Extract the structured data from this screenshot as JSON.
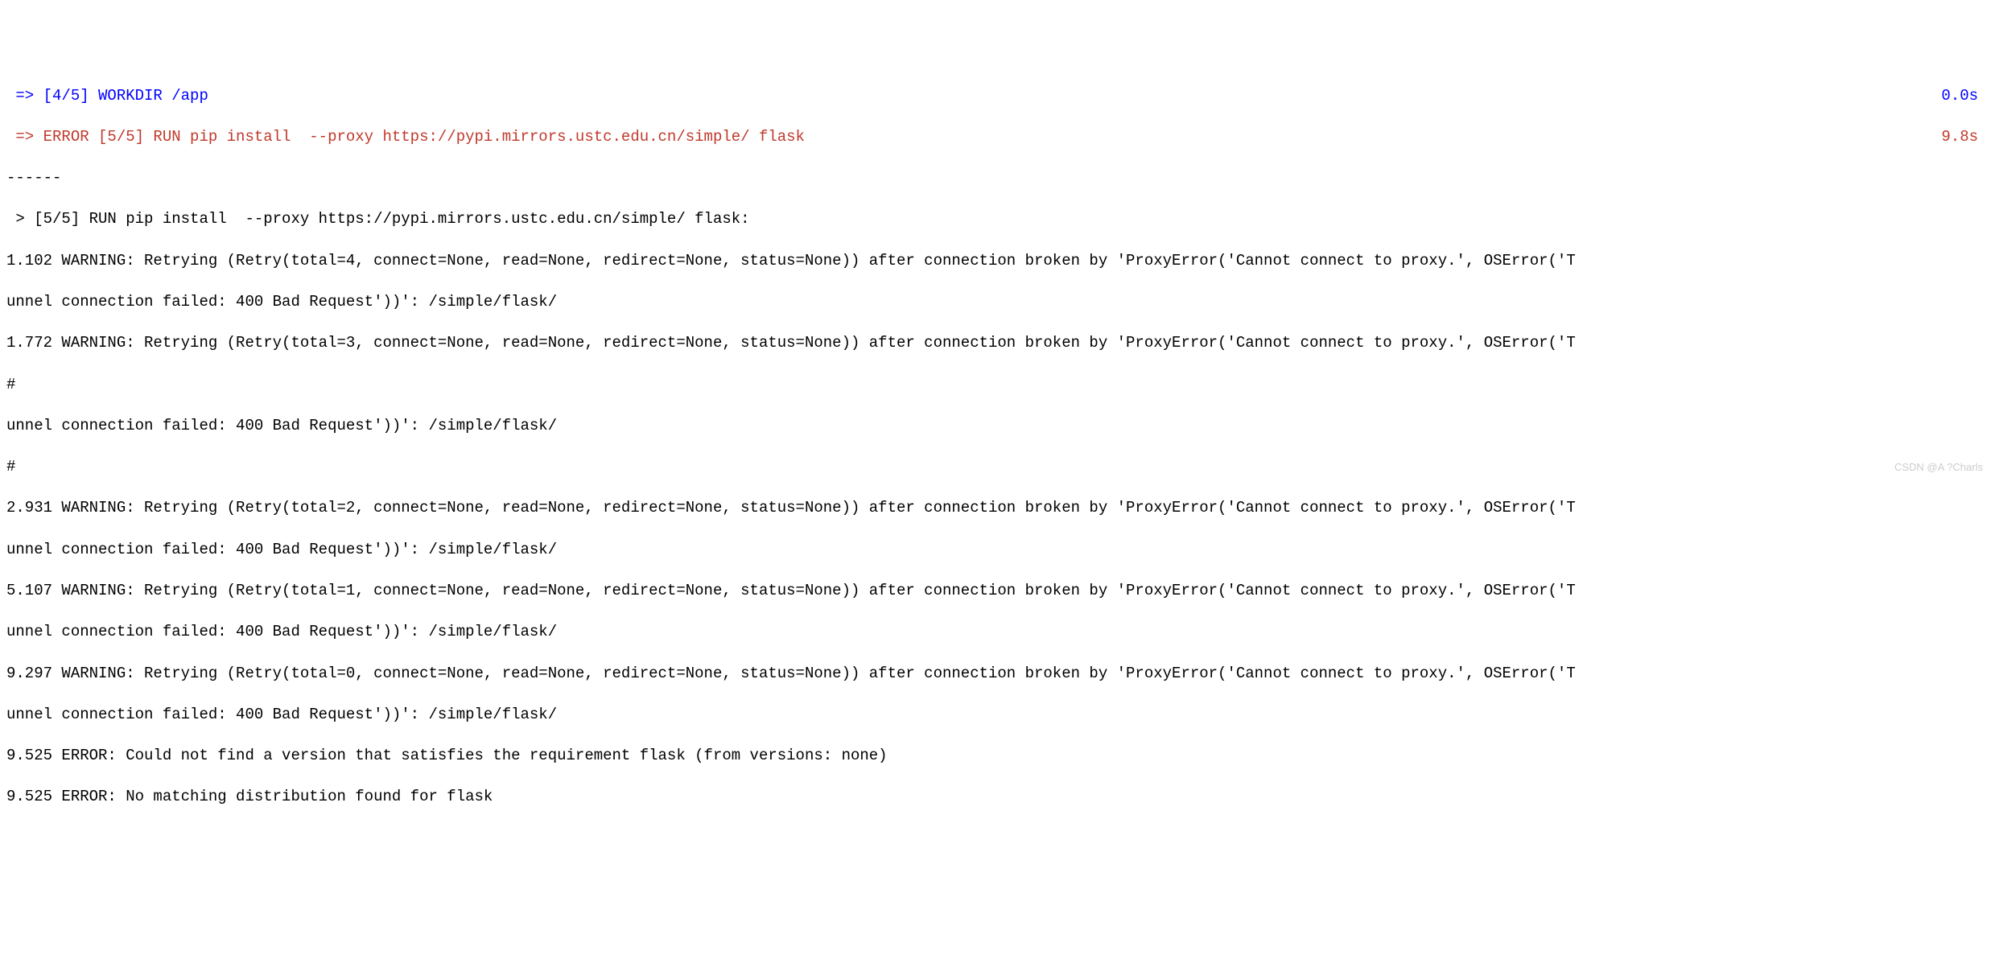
{
  "step1": {
    "arrow": " => ",
    "text": "[4/5] WORKDIR /app",
    "time": "0.0s"
  },
  "step2": {
    "arrow": " => ",
    "text": "ERROR [5/5] RUN pip install  --proxy https://pypi.mirrors.ustc.edu.cn/simple/ flask",
    "time": "9.8s"
  },
  "divider": "------",
  "detail_header": " > [5/5] RUN pip install  --proxy https://pypi.mirrors.ustc.edu.cn/simple/ flask:",
  "out": {
    "l1": "1.102 WARNING: Retrying (Retry(total=4, connect=None, read=None, redirect=None, status=None)) after connection broken by 'ProxyError('Cannot connect to proxy.', OSError('T",
    "l2": "unnel connection failed: 400 Bad Request'))': /simple/flask/",
    "l3": "1.772 WARNING: Retrying (Retry(total=3, connect=None, read=None, redirect=None, status=None)) after connection broken by 'ProxyError('Cannot connect to proxy.', OSError('T",
    "hash": "#",
    "l4": "unnel connection failed: 400 Bad Request'))': /simple/flask/",
    "l5": "2.931 WARNING: Retrying (Retry(total=2, connect=None, read=None, redirect=None, status=None)) after connection broken by 'ProxyError('Cannot connect to proxy.', OSError('T",
    "l6": "unnel connection failed: 400 Bad Request'))': /simple/flask/",
    "l7": "5.107 WARNING: Retrying (Retry(total=1, connect=None, read=None, redirect=None, status=None)) after connection broken by 'ProxyError('Cannot connect to proxy.', OSError('T",
    "l8": "unnel connection failed: 400 Bad Request'))': /simple/flask/",
    "l9": "9.297 WARNING: Retrying (Retry(total=0, connect=None, read=None, redirect=None, status=None)) after connection broken by 'ProxyError('Cannot connect to proxy.', OSError('T",
    "l10": "unnel connection failed: 400 Bad Request'))': /simple/flask/",
    "l11": "9.525 ERROR: Could not find a version that satisfies the requirement flask (from versions: none)",
    "l12": "9.525 ERROR: No matching distribution found for flask"
  },
  "watermark": "CSDN @A ?Charls"
}
